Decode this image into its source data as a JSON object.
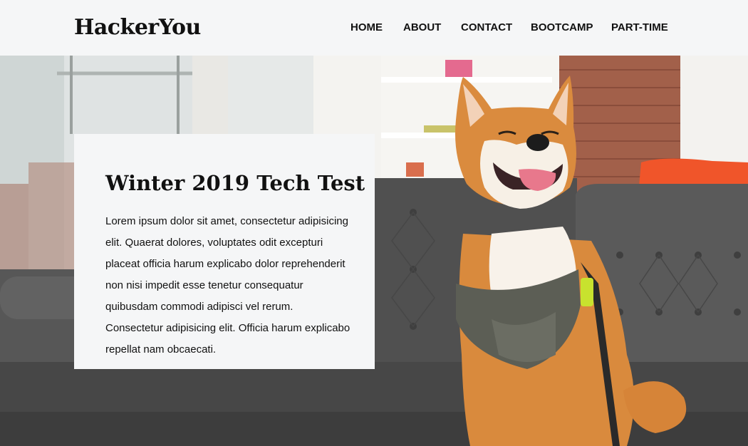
{
  "header": {
    "logo": "HackerYou",
    "nav": [
      {
        "label": "HOME"
      },
      {
        "label": "ABOUT"
      },
      {
        "label": "CONTACT"
      },
      {
        "label": "BOOTCAMP"
      },
      {
        "label": "PART-TIME"
      }
    ]
  },
  "hero": {
    "image_subject": "shiba-inu-dog-on-couch"
  },
  "card": {
    "title": "Winter 2019 Tech Test",
    "body": "Lorem ipsum dolor sit amet, consectetur adipisicing elit. Quaerat dolores, voluptates odit excepturi placeat officia harum explicabo dolor reprehenderit non nisi impedit esse tenetur consequatur quibusdam commodi adipisci vel rerum. Consectetur adipisicing elit. Officia harum explicabo repellat nam obcaecati."
  },
  "colors": {
    "background": "#f5f6f7",
    "text": "#111111"
  }
}
